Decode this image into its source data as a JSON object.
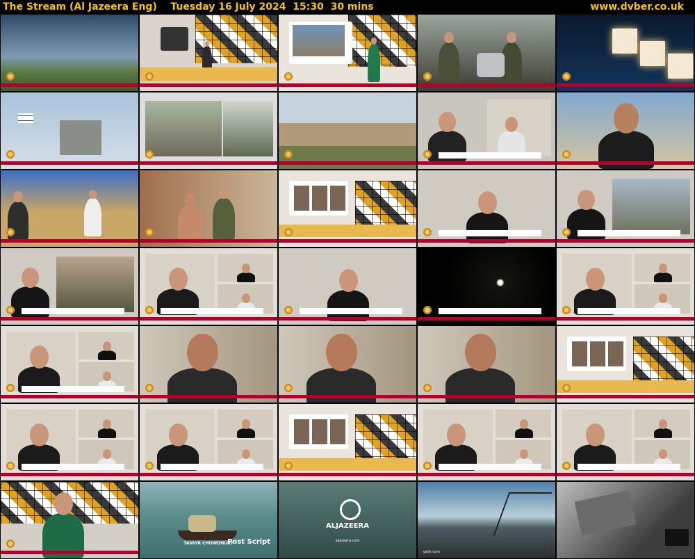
{
  "header": {
    "channel": "The Stream (Al Jazeera Eng)",
    "date": "Tuesday 16 July 2024",
    "time": "15:30",
    "duration": "30 mins",
    "site": "www.dvber.co.uk"
  },
  "grid": {
    "columns": 5,
    "rows": 7
  },
  "colors": {
    "title": "#f5c400",
    "ticker": "#b3002d",
    "background": "#000000"
  },
  "tiles": [
    {
      "type": "sky"
    },
    {
      "type": "studio-wide"
    },
    {
      "type": "studio-presenter"
    },
    {
      "type": "soldiers"
    },
    {
      "type": "studio-blocks"
    },
    {
      "type": "watchtower"
    },
    {
      "type": "video-split"
    },
    {
      "type": "landscape"
    },
    {
      "type": "guest-split"
    },
    {
      "type": "guest-selfie"
    },
    {
      "type": "soldiers-field"
    },
    {
      "type": "confrontation"
    },
    {
      "type": "studio-screen"
    },
    {
      "type": "guest-single"
    },
    {
      "type": "guest-split-outdoor"
    },
    {
      "type": "guest-split-field"
    },
    {
      "type": "panel-three"
    },
    {
      "type": "guest-single"
    },
    {
      "type": "night"
    },
    {
      "type": "panel-three"
    },
    {
      "type": "panel-three"
    },
    {
      "type": "guest-glasses"
    },
    {
      "type": "guest-glasses"
    },
    {
      "type": "guest-glasses"
    },
    {
      "type": "studio-screen"
    },
    {
      "type": "panel-three"
    },
    {
      "type": "panel-three"
    },
    {
      "type": "studio-screen"
    },
    {
      "type": "panel-three"
    },
    {
      "type": "panel-three"
    },
    {
      "type": "presenter"
    },
    {
      "type": "boat"
    },
    {
      "type": "logo-water"
    },
    {
      "type": "promo-city"
    },
    {
      "type": "promo-ink"
    }
  ],
  "tile_texts": {
    "boat_name": "TANVIR CHOWDHURY",
    "boat_brand": "Post Script",
    "logo_text": "ALJAZEERA",
    "logo_url": "aljazeera.com",
    "promo_city_tag": "gettr.com"
  }
}
